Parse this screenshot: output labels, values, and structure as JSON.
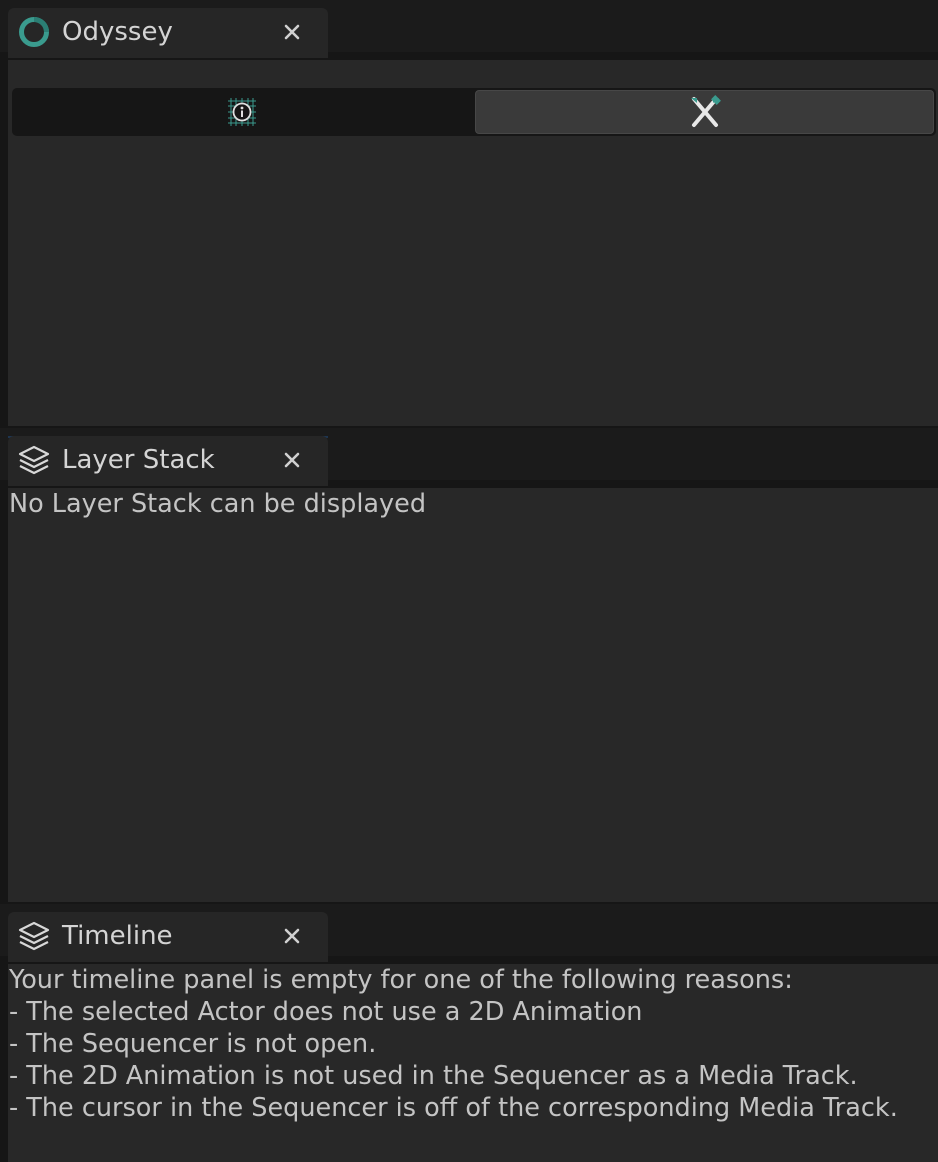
{
  "panels": {
    "odyssey": {
      "tab_title": "Odyssey",
      "icon": "odyssey-ring-icon",
      "close_icon": "close-icon",
      "toggle": {
        "left_icon": "info-grid-icon",
        "right_icon": "crossed-brushes-icon",
        "selected": "right"
      }
    },
    "layer_stack": {
      "tab_title": "Layer Stack",
      "icon": "layers-icon",
      "close_icon": "close-icon",
      "message": "No Layer Stack can be displayed"
    },
    "timeline": {
      "tab_title": "Timeline",
      "icon": "layers-icon",
      "close_icon": "close-icon",
      "message_lines": [
        "Your timeline panel is empty for one of the following reasons:",
        "- The selected Actor does not use a 2D Animation",
        "- The Sequencer is not open.",
        "- The 2D Animation is not used in the Sequencer as a Media Track.",
        "- The cursor in the Sequencer is off of the corresponding Media Track."
      ]
    }
  },
  "colors": {
    "accent_teal": "#3a9b8e",
    "panel_bg": "#282828",
    "tab_bg": "#262626",
    "tabbar_bg": "#1b1b1b",
    "active_tab_line": "#2d5d95"
  }
}
